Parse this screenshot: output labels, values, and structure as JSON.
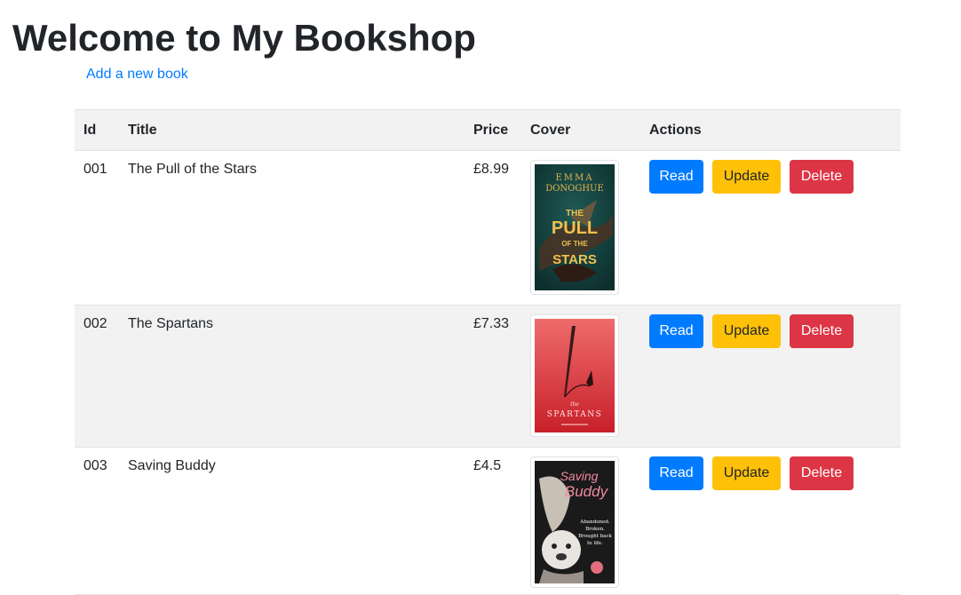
{
  "page": {
    "heading": "Welcome to My Bookshop",
    "add_link": "Add a new book"
  },
  "table": {
    "headers": {
      "id": "Id",
      "title": "Title",
      "price": "Price",
      "cover": "Cover",
      "actions": "Actions"
    },
    "rows": [
      {
        "id": "001",
        "title": "The Pull of the Stars",
        "price": "£8.99",
        "cover": {
          "author_line1": "EMMA",
          "author_line2": "DONOGHUE",
          "title_line1": "THE",
          "title_line2": "PULL",
          "title_line3": "OF THE",
          "title_line4": "STARS"
        }
      },
      {
        "id": "002",
        "title": "The Spartans",
        "price": "£7.33",
        "cover": {
          "small": "the",
          "title": "SPARTANS"
        }
      },
      {
        "id": "003",
        "title": "Saving Buddy",
        "price": "£4.5",
        "cover": {
          "title_line1": "Saving",
          "title_line2": "Buddy",
          "blurb1": "Abandoned.",
          "blurb2": "Broken.",
          "blurb3": "Brought back",
          "blurb4": "to life."
        }
      }
    ],
    "actions": {
      "read": "Read",
      "update": "Update",
      "delete": "Delete"
    }
  },
  "colors": {
    "link": "#007bff",
    "read": "#007bff",
    "update": "#ffc107",
    "delete": "#dc3545",
    "stripe": "#f2f2f2"
  }
}
